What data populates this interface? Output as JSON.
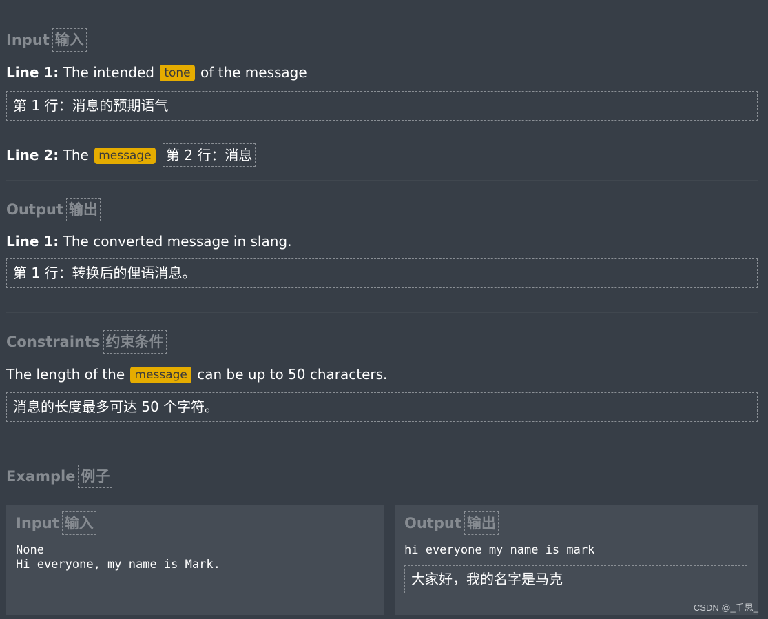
{
  "input": {
    "heading": "Input",
    "heading_zh": "输入",
    "line1_label": "Line 1:",
    "line1_pre": "The intended",
    "line1_tag": "tone",
    "line1_post": "of the message",
    "line1_zh": "第 1 行：消息的预期语气",
    "line2_label": "Line 2:",
    "line2_pre": "The",
    "line2_tag": "message",
    "line2_zh": "第 2 行：消息"
  },
  "output": {
    "heading": "Output",
    "heading_zh": "输出",
    "line1_label": "Line 1:",
    "line1_text": "The converted message in slang.",
    "line1_zh": "第 1 行：转换后的俚语消息。"
  },
  "constraints": {
    "heading": "Constraints",
    "heading_zh": "约束条件",
    "pre": "The length of the",
    "tag": "message",
    "post": "can be up to 50 characters.",
    "zh": "消息的长度最多可达 50 个字符。"
  },
  "example": {
    "heading": "Example",
    "heading_zh": "例子",
    "input_panel": {
      "heading": "Input",
      "heading_zh": "输入",
      "lines": "None\nHi everyone, my name is Mark."
    },
    "output_panel": {
      "heading": "Output",
      "heading_zh": "输出",
      "lines": "hi everyone my name is mark",
      "zh": "大家好，我的名字是马克"
    }
  },
  "watermark": "CSDN @_千思_",
  "colors": {
    "background": "#373e47",
    "panel": "#454c55",
    "tag": "#e5ac00",
    "heading": "#868b91"
  }
}
